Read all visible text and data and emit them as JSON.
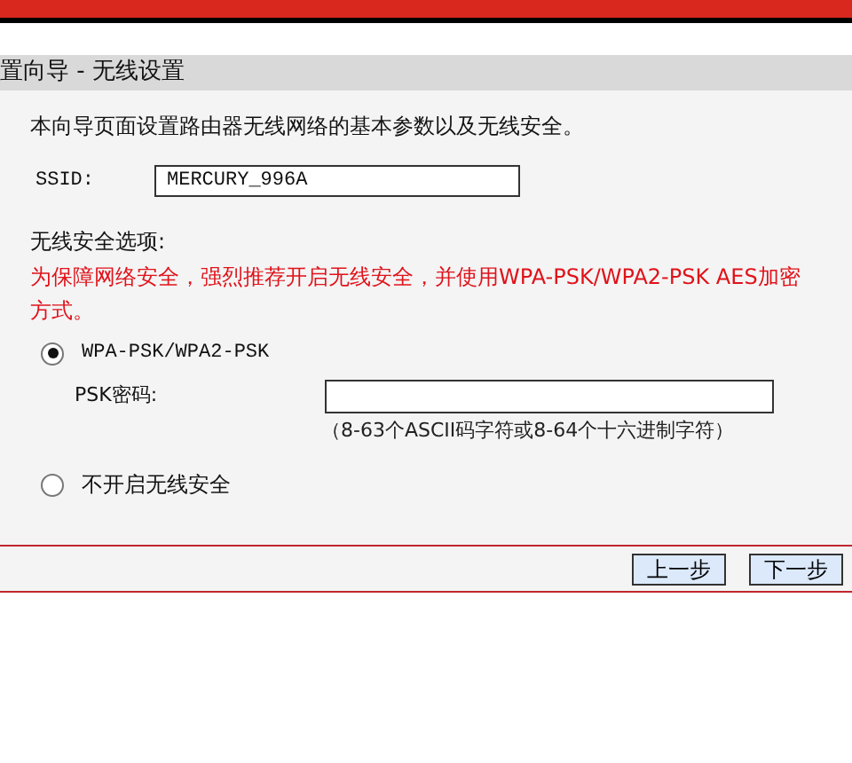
{
  "title": "置向导 - 无线设置",
  "intro": "本向导页面设置路由器无线网络的基本参数以及无线安全。",
  "ssid": {
    "label": "SSID:",
    "value": "MERCURY_996A"
  },
  "security": {
    "heading": "无线安全选项:",
    "warning": "为保障网络安全，强烈推荐开启无线安全，并使用WPA-PSK/WPA2-PSK AES加密方式。",
    "options": [
      {
        "label": "WPA-PSK/WPA2-PSK",
        "selected": true,
        "kind": "psk"
      },
      {
        "label": "不开启无线安全",
        "selected": false,
        "kind": "none"
      }
    ],
    "psk": {
      "label": "PSK密码:",
      "hint": "（8-63个ASCII码字符或8-64个十六进制字符）"
    }
  },
  "buttons": [
    "上一步",
    "下一步"
  ]
}
